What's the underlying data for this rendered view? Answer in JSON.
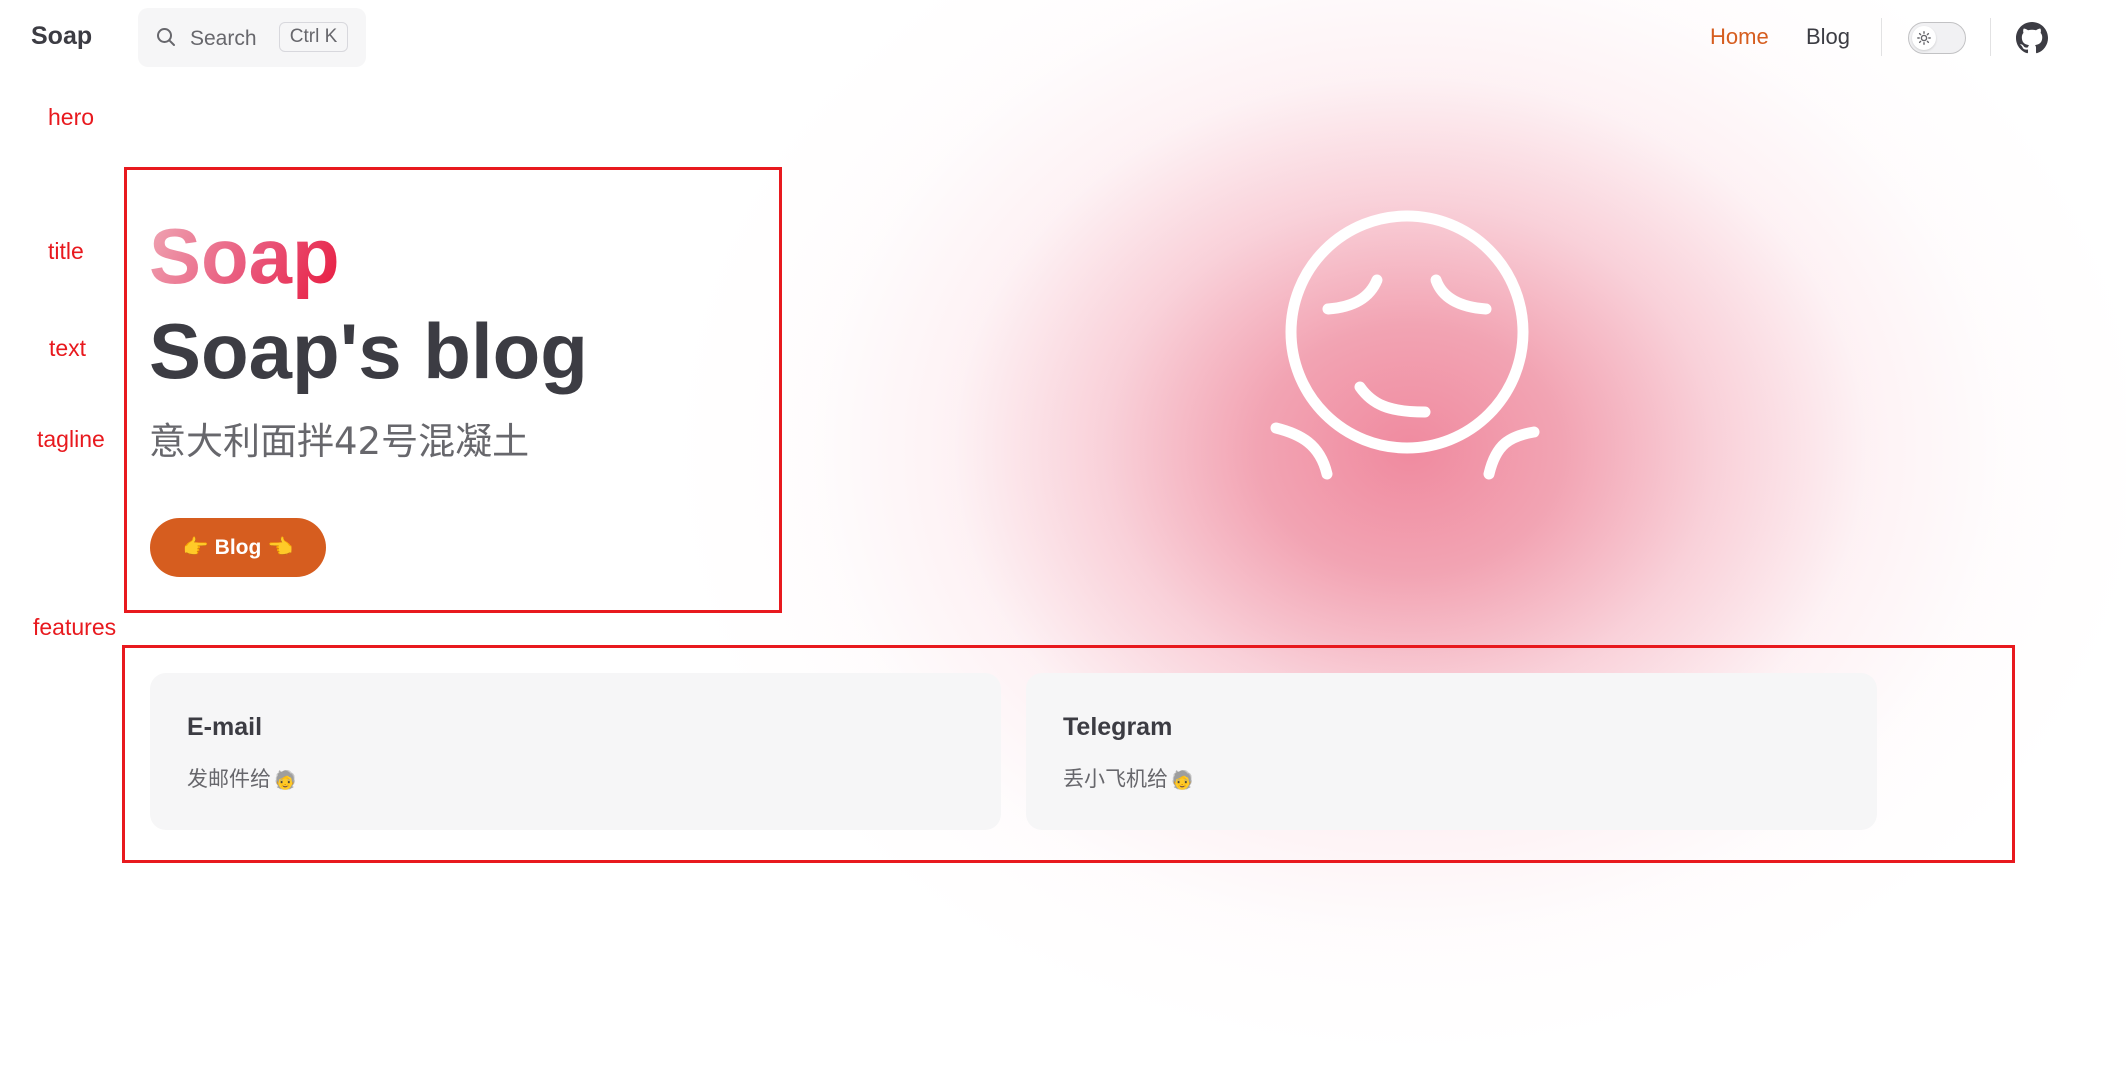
{
  "nav": {
    "brand": "Soap",
    "search_label": "Search",
    "search_shortcut": "Ctrl K",
    "links": [
      {
        "label": "Home",
        "active": true
      },
      {
        "label": "Blog",
        "active": false
      }
    ],
    "theme_toggle_icon": "sun-icon",
    "social_icon": "github-icon"
  },
  "annotations": {
    "hero": "hero",
    "title": "title",
    "text": "text",
    "tagline": "tagline",
    "features": "features"
  },
  "hero": {
    "name": "Soap",
    "text": "Soap's blog",
    "tagline": "意大利面拌42号混凝土",
    "action_label": "Blog",
    "action_emoji_left": "👉",
    "action_emoji_right": "👈"
  },
  "features": [
    {
      "title": "E-mail",
      "details": "发邮件给",
      "emoji": "🧓"
    },
    {
      "title": "Telegram",
      "details": "丢小飞机给",
      "emoji": "🧓"
    }
  ],
  "colors": {
    "brand_orange": "#d65d1f",
    "annotation_red": "#e8191e",
    "glow_pink": "#ef849a"
  }
}
